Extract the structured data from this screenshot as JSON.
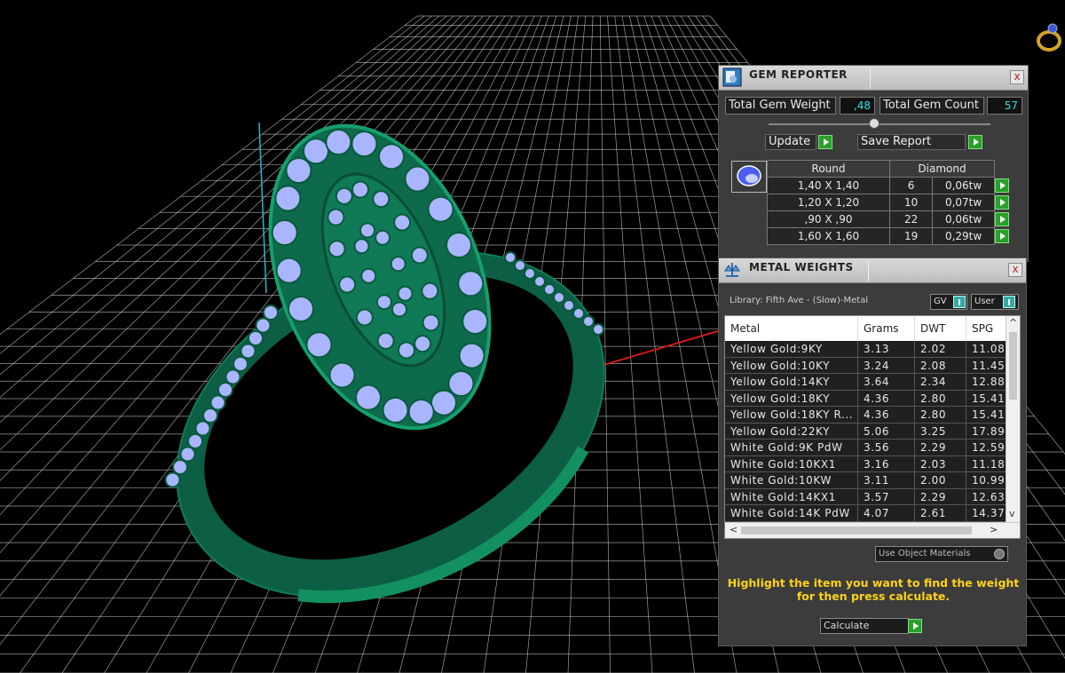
{
  "gem_reporter": {
    "title": "GEM REPORTER",
    "close": "x",
    "total_gem_weight_label": "Total Gem Weight",
    "total_gem_weight_value": ",48",
    "total_gem_count_label": "Total Gem Count",
    "total_gem_count_value": "57",
    "update_label": "Update",
    "save_report_label": "Save Report",
    "table_header": {
      "shape": "Round",
      "stone": "Diamond"
    },
    "rows": [
      {
        "size": "1,40 X 1,40",
        "count": "6",
        "weight": "0,06tw"
      },
      {
        "size": "1,20 X 1,20",
        "count": "10",
        "weight": "0,07tw"
      },
      {
        "size": ",90 X ,90",
        "count": "22",
        "weight": "0,06tw"
      },
      {
        "size": "1,60 X 1,60",
        "count": "19",
        "weight": "0,29tw"
      }
    ]
  },
  "metal_weights": {
    "title": "METAL WEIGHTS",
    "close": "x",
    "library_label": "Library: Fifth Ave - (Slow)-Metal",
    "gv_label": "GV",
    "user_label": "User",
    "columns": [
      "Metal",
      "Grams",
      "DWT",
      "SPG"
    ],
    "rows": [
      {
        "metal": "Yellow Gold:9KY",
        "grams": "3.13",
        "dwt": "2.02",
        "spg": "11.08"
      },
      {
        "metal": "Yellow Gold:10KY",
        "grams": "3.24",
        "dwt": "2.08",
        "spg": "11.45"
      },
      {
        "metal": "Yellow Gold:14KY",
        "grams": "3.64",
        "dwt": "2.34",
        "spg": "12.88"
      },
      {
        "metal": "Yellow Gold:18KY",
        "grams": "4.36",
        "dwt": "2.80",
        "spg": "15.41"
      },
      {
        "metal": "Yellow Gold:18KY R...",
        "grams": "4.36",
        "dwt": "2.80",
        "spg": "15.41"
      },
      {
        "metal": "Yellow Gold:22KY",
        "grams": "5.06",
        "dwt": "3.25",
        "spg": "17.89"
      },
      {
        "metal": "White Gold:9K PdW",
        "grams": "3.56",
        "dwt": "2.29",
        "spg": "12.59"
      },
      {
        "metal": "White Gold:10KX1",
        "grams": "3.16",
        "dwt": "2.03",
        "spg": "11.18"
      },
      {
        "metal": "White Gold:10KW",
        "grams": "3.11",
        "dwt": "2.00",
        "spg": "10.99"
      },
      {
        "metal": "White Gold:14KX1",
        "grams": "3.57",
        "dwt": "2.29",
        "spg": "12.63"
      },
      {
        "metal": "White Gold:14K PdW",
        "grams": "4.07",
        "dwt": "2.61",
        "spg": "14.37"
      }
    ],
    "use_object_materials_label": "Use Object Materials",
    "hint_line1": "Highlight the item you want to find the weight",
    "hint_line2": "for then press calculate.",
    "calculate_label": "Calculate"
  },
  "colors": {
    "ring_green": "#0f7a55",
    "gem_blue": "#a9b6ff",
    "grid": "#cfcfcf",
    "hint_yellow": "#ffd21a",
    "value_cyan": "#33e0e0"
  },
  "icons": {
    "gem_reporter": "report-icon",
    "metal_weights": "scale-icon",
    "diamond": "round-gem-icon",
    "ring_logo": "ring-icon"
  }
}
